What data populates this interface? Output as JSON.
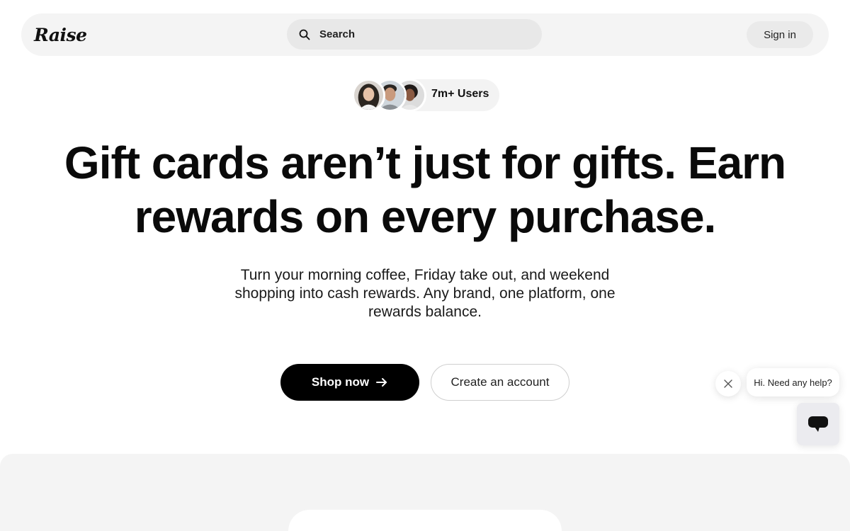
{
  "header": {
    "logo_text": "Raise",
    "search_label": "Search",
    "signin_label": "Sign in"
  },
  "social_proof": {
    "users_label": "7m+ Users",
    "avatar_count": 3
  },
  "hero": {
    "title": "Gift cards aren’t just for gifts. Earn rewards on every purchase.",
    "subtitle": "Turn your morning coffee, Friday take out, and weekend shopping into cash rewards. Any brand, one platform, one rewards balance."
  },
  "cta": {
    "shop_label": "Shop now",
    "create_label": "Create an account"
  },
  "help_widget": {
    "message": "Hi. Need any help?"
  },
  "colors": {
    "primary": "#000000",
    "background": "#ffffff",
    "surface": "#f4f4f4",
    "search_bg": "#e8e8e8"
  },
  "icons": [
    "search-icon",
    "arrow-right-icon",
    "close-icon",
    "chat-icon"
  ]
}
